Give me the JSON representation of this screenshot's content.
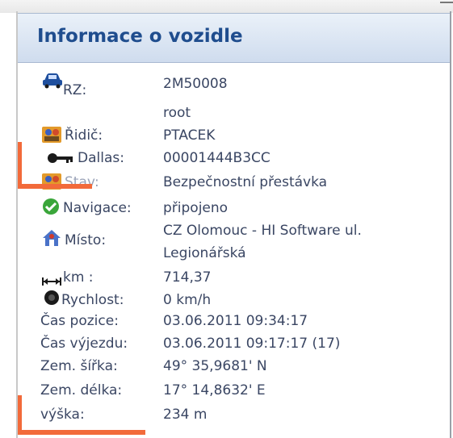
{
  "window": {
    "title": "Informace o vozidle"
  },
  "rows": [
    {
      "icon": "car-icon",
      "label": "RZ:",
      "value": "2M50008"
    },
    {
      "label": "",
      "value": "root"
    },
    {
      "icon": "driver-icon",
      "label": "Řidič:",
      "value": "PTACEK"
    },
    {
      "icon": "key-icon",
      "label": "Dallas:",
      "value": "00001444B3CC"
    },
    {
      "icon": "status-icon",
      "label": "Stav:",
      "value": "Bezpečnostní přestávka"
    },
    {
      "icon": "check-icon",
      "label": "Navigace:",
      "value": "připojeno"
    },
    {
      "icon": "location-icon",
      "label": "Místo:",
      "value": "CZ Olomouc - HI Software ul.",
      "value2": "Legionářská"
    },
    {
      "icon": "distance-icon",
      "label": "km :",
      "value": "714,37"
    },
    {
      "icon": "speedometer-icon",
      "label": "Rychlost:",
      "value": "0 km/h"
    },
    {
      "label": "Čas pozice:",
      "value": "03.06.2011 09:34:17"
    },
    {
      "label": "Čas výjezdu:",
      "value": "03.06.2011 09:17:17 (17)"
    },
    {
      "label": "Zem. šířka:",
      "value": "49° 35,9681' N"
    },
    {
      "label": "Zem. délka:",
      "value": "17° 14,8632' E"
    },
    {
      "label": "výška:",
      "value": "234 m"
    }
  ],
  "colors": {
    "annotation": "#f26a3a",
    "title": "#1f4d8e"
  }
}
